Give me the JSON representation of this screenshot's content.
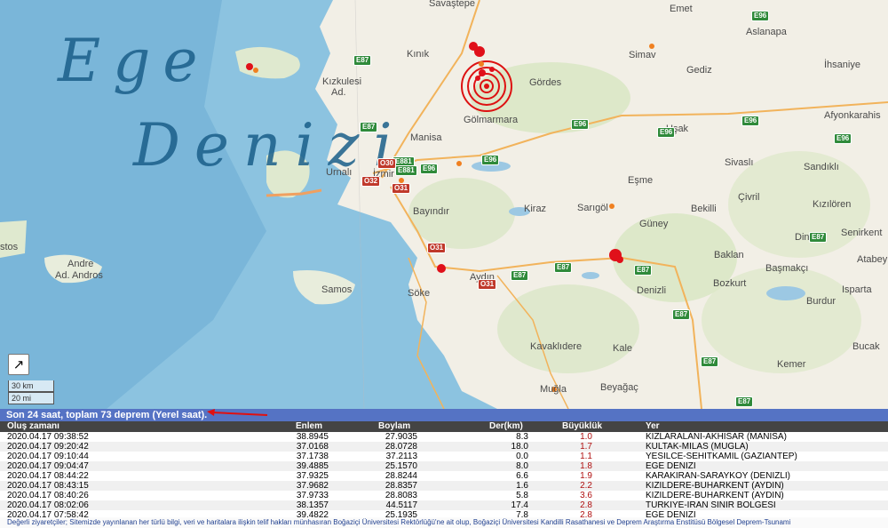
{
  "map": {
    "sea_label": [
      "Ege",
      "Denizi"
    ],
    "places": [
      {
        "id": "savastepe",
        "text": "Savaştepe"
      },
      {
        "id": "emet",
        "text": "Emet"
      },
      {
        "id": "kinik",
        "text": "Kınık"
      },
      {
        "id": "aslanapa",
        "text": "Aslanapa"
      },
      {
        "id": "simav",
        "text": "Simav"
      },
      {
        "id": "gediz",
        "text": "Gediz"
      },
      {
        "id": "ihsaniye",
        "text": "İhsaniye"
      },
      {
        "id": "kizkulesi",
        "text": "Kızkulesi"
      },
      {
        "id": "ad",
        "text": "Ad."
      },
      {
        "id": "gordes",
        "text": "Gördes"
      },
      {
        "id": "golmarmara",
        "text": "Gölmarmara"
      },
      {
        "id": "afyon",
        "text": "Afyonkarahis"
      },
      {
        "id": "manisa",
        "text": "Manisa"
      },
      {
        "id": "usak",
        "text": "Uşak"
      },
      {
        "id": "ornali",
        "text": "Urnalı"
      },
      {
        "id": "izmir",
        "text": "İzmir"
      },
      {
        "id": "sivasli",
        "text": "Sivaslı"
      },
      {
        "id": "sandikli",
        "text": "Sandıklı"
      },
      {
        "id": "esme",
        "text": "Eşme"
      },
      {
        "id": "bayindir",
        "text": "Bayındır"
      },
      {
        "id": "kiraz",
        "text": "Kiraz"
      },
      {
        "id": "sarigol",
        "text": "Sarıgöl"
      },
      {
        "id": "civril",
        "text": "Çivril"
      },
      {
        "id": "kiziloren",
        "text": "Kızılören"
      },
      {
        "id": "guney",
        "text": "Güney"
      },
      {
        "id": "bekilli",
        "text": "Bekilli"
      },
      {
        "id": "stos",
        "text": "stos"
      },
      {
        "id": "dinar",
        "text": "Dinar"
      },
      {
        "id": "senirkent",
        "text": "Senirkent"
      },
      {
        "id": "andros",
        "text": "Andre"
      },
      {
        "id": "adandros",
        "text": "Ad. Andros"
      },
      {
        "id": "baklan",
        "text": "Baklan"
      },
      {
        "id": "atabey",
        "text": "Atabey"
      },
      {
        "id": "samos",
        "text": "Samos"
      },
      {
        "id": "soke",
        "text": "Söke"
      },
      {
        "id": "aydin",
        "text": "Aydın"
      },
      {
        "id": "denizli",
        "text": "Denizli"
      },
      {
        "id": "basmakci",
        "text": "Başmakçı"
      },
      {
        "id": "isparta",
        "text": "Isparta"
      },
      {
        "id": "bozkurt",
        "text": "Bozkurt"
      },
      {
        "id": "burdur",
        "text": "Burdur"
      },
      {
        "id": "kavaklidere",
        "text": "Kavaklıdere"
      },
      {
        "id": "kale",
        "text": "Kale"
      },
      {
        "id": "bucak",
        "text": "Bucak"
      },
      {
        "id": "kemer",
        "text": "Kemer"
      },
      {
        "id": "mugla",
        "text": "Muğla"
      },
      {
        "id": "beyagac",
        "text": "Beyağaç"
      }
    ],
    "shields": [
      {
        "id": "e87a",
        "text": "E87",
        "kind": "e"
      },
      {
        "id": "e96a",
        "text": "E96",
        "kind": "e"
      },
      {
        "id": "e87b",
        "text": "E87",
        "kind": "e"
      },
      {
        "id": "e96b",
        "text": "E96",
        "kind": "e"
      },
      {
        "id": "e96c",
        "text": "E96",
        "kind": "e"
      },
      {
        "id": "e96d",
        "text": "E96",
        "kind": "e"
      },
      {
        "id": "e96e",
        "text": "E96",
        "kind": "e"
      },
      {
        "id": "e881a",
        "text": "E881",
        "kind": "e"
      },
      {
        "id": "e881b",
        "text": "E881",
        "kind": "e"
      },
      {
        "id": "e96f",
        "text": "E96",
        "kind": "e"
      },
      {
        "id": "e96g",
        "text": "E96",
        "kind": "e"
      },
      {
        "id": "e87c",
        "text": "E87",
        "kind": "e"
      },
      {
        "id": "e87d",
        "text": "E87",
        "kind": "e"
      },
      {
        "id": "e87e",
        "text": "E87",
        "kind": "e"
      },
      {
        "id": "e87f",
        "text": "E87",
        "kind": "e"
      },
      {
        "id": "e87g",
        "text": "E87",
        "kind": "e"
      },
      {
        "id": "e87h",
        "text": "E87",
        "kind": "e"
      },
      {
        "id": "e87i",
        "text": "E87",
        "kind": "e"
      },
      {
        "id": "o30",
        "text": "O30",
        "kind": "o"
      },
      {
        "id": "o32",
        "text": "O32",
        "kind": "o"
      },
      {
        "id": "o31a",
        "text": "O31",
        "kind": "o"
      },
      {
        "id": "o31b",
        "text": "O31",
        "kind": "o"
      },
      {
        "id": "o31c",
        "text": "O31",
        "kind": "o"
      }
    ],
    "scale": {
      "km": "30 km",
      "mi": "20 mi"
    },
    "expand_icon": "expand-arrow-icon"
  },
  "summary": "Son 24 saat, toplam 73 deprem (Yerel saat).",
  "table": {
    "headers": {
      "time": "Oluş zamanı",
      "lat": "Enlem",
      "lon": "Boylam",
      "depth": "Der(km)",
      "mag": "Büyüklük",
      "place": "Yer"
    },
    "rows": [
      {
        "time": "2020.04.17 09:38:52",
        "lat": "38.8945",
        "lon": "27.9035",
        "depth": "8.3",
        "mag": "1.0",
        "place": "KIZLARALANI-AKHISAR (MANISA)"
      },
      {
        "time": "2020.04.17 09:20:42",
        "lat": "37.0168",
        "lon": "28.0728",
        "depth": "18.0",
        "mag": "1.7",
        "place": "KULTAK-MILAS (MUGLA)"
      },
      {
        "time": "2020.04.17 09:10:44",
        "lat": "37.1738",
        "lon": "37.2113",
        "depth": "0.0",
        "mag": "1.1",
        "place": "YESILCE-SEHITKAMIL (GAZIANTEP)"
      },
      {
        "time": "2020.04.17 09:04:47",
        "lat": "39.4885",
        "lon": "25.1570",
        "depth": "8.0",
        "mag": "1.8",
        "place": "EGE DENIZI"
      },
      {
        "time": "2020.04.17 08:44:22",
        "lat": "37.9325",
        "lon": "28.8244",
        "depth": "6.6",
        "mag": "1.9",
        "place": "KARAKIRAN-SARAYKOY (DENIZLI)"
      },
      {
        "time": "2020.04.17 08:43:15",
        "lat": "37.9682",
        "lon": "28.8357",
        "depth": "1.6",
        "mag": "2.2",
        "place": "KIZILDERE-BUHARKENT (AYDIN)"
      },
      {
        "time": "2020.04.17 08:40:26",
        "lat": "37.9733",
        "lon": "28.8083",
        "depth": "5.8",
        "mag": "3.6",
        "place": "KIZILDERE-BUHARKENT (AYDIN)"
      },
      {
        "time": "2020.04.17 08:02:06",
        "lat": "38.1357",
        "lon": "44.5117",
        "depth": "17.4",
        "mag": "2.8",
        "place": "TURKIYE-IRAN SINIR BOLGESI"
      },
      {
        "time": "2020.04.17 07:58:42",
        "lat": "39.4822",
        "lon": "25.1935",
        "depth": "7.8",
        "mag": "2.8",
        "place": "EGE DENIZI"
      }
    ]
  },
  "notice": "Değerli ziyaretçiler; Sitemizde yayınlanan her türlü bilgi, veri ve haritalara ilişkin telif hakları münhasıran Boğaziçi Üniversitesi Rektörlüğü'ne ait olup, Boğaziçi Üniversitesi Kandilli Rasathanesi ve Deprem Araştırma Enstitüsü Bölgesel Deprem-Tsunami"
}
